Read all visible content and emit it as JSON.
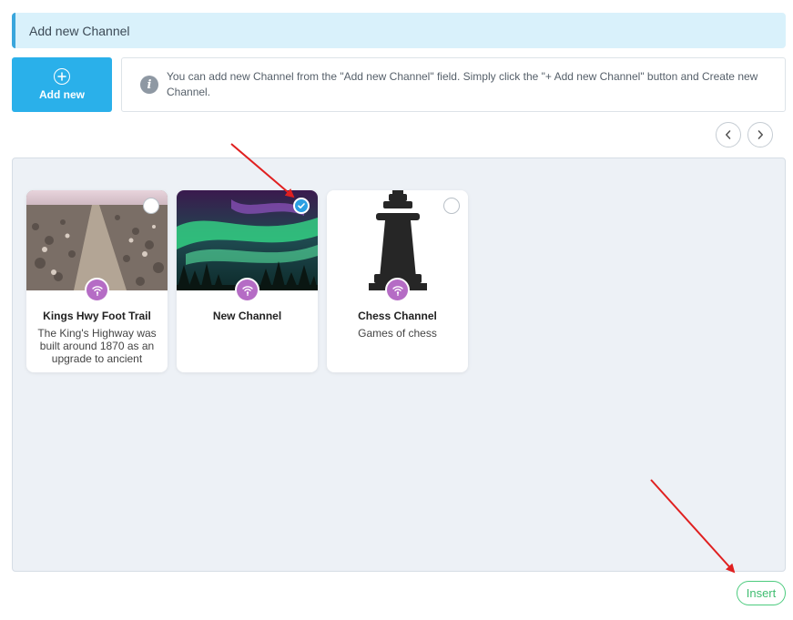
{
  "header": {
    "title": "Add new Channel"
  },
  "add_new": {
    "label": "Add new",
    "icon": "plus-circle-icon"
  },
  "info": {
    "icon": "info-icon",
    "text": "You can add new Channel from the \"Add new Channel\" field. Simply click the \"+ Add new Channel\" button and Create new Channel."
  },
  "pager": {
    "prev_icon": "chevron-left-icon",
    "next_icon": "chevron-right-icon"
  },
  "channels": [
    {
      "title": "Kings Hwy Foot Trail",
      "description": "The King's Highway was built around 1870 as an upgrade to ancient",
      "selected": false
    },
    {
      "title": "New Channel",
      "description": "",
      "selected": true
    },
    {
      "title": "Chess Channel",
      "description": "Games of chess",
      "selected": false
    }
  ],
  "actions": {
    "insert_label": "Insert"
  },
  "colors": {
    "accent": "#2ab0ea",
    "badge": "#b56cc5",
    "check": "#2b9fe2",
    "insert": "#3fbd70",
    "annotation_arrow": "#e02020"
  }
}
